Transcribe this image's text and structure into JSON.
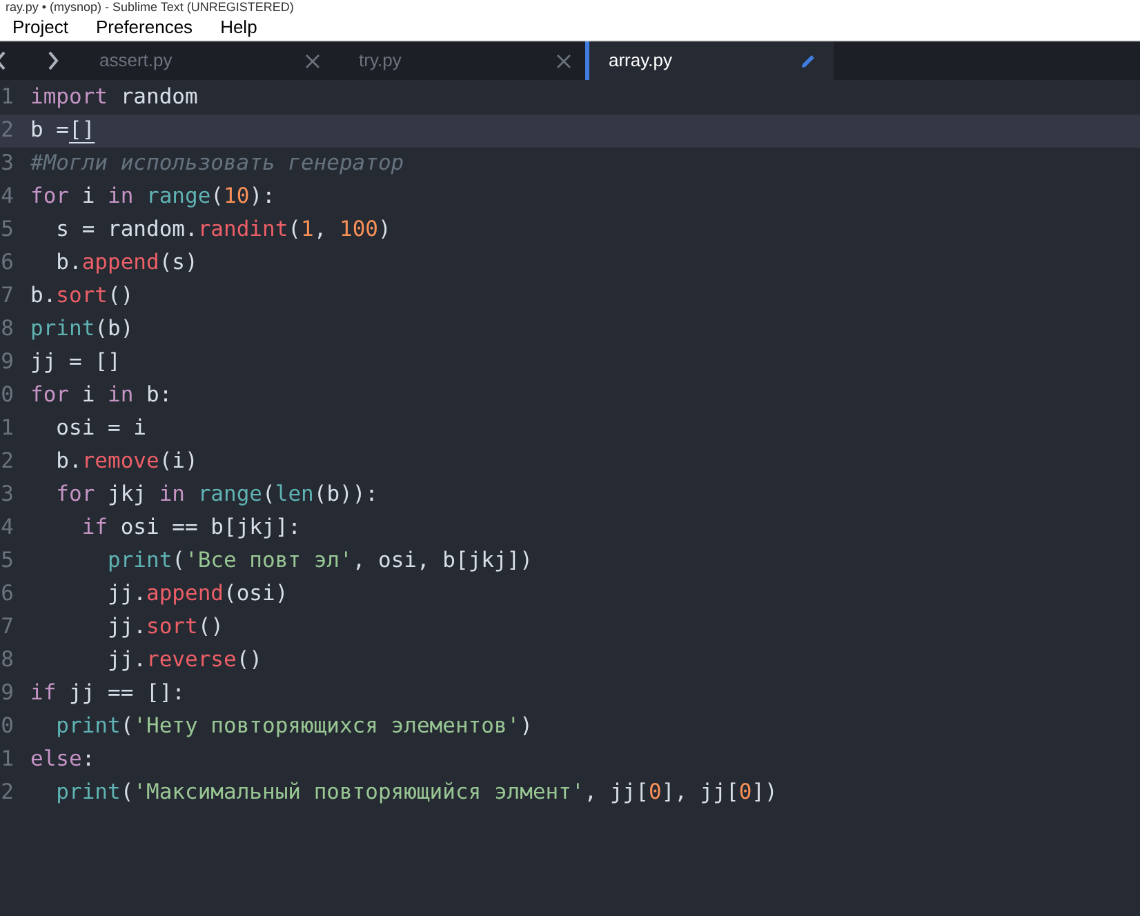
{
  "window": {
    "title": "ray.py • (mysnop) - Sublime Text (UNREGISTERED)"
  },
  "menu": [
    "Project",
    "Preferences",
    "Help"
  ],
  "tabs": [
    {
      "label": "assert.py",
      "selected": false,
      "modified": false
    },
    {
      "label": "try.py",
      "selected": false,
      "modified": false
    },
    {
      "label": "array.py",
      "selected": true,
      "modified": true
    }
  ],
  "lines": [
    {
      "number": "1",
      "current": false,
      "tokens": [
        {
          "kind": "kw",
          "text": "import"
        },
        {
          "kind": "tx",
          "text": " random"
        }
      ]
    },
    {
      "number": "2",
      "current": true,
      "tokens": [
        {
          "kind": "tx",
          "text": "b ="
        },
        {
          "kind": "match",
          "text": "[]"
        }
      ]
    },
    {
      "number": "3",
      "current": false,
      "tokens": [
        {
          "kind": "cm",
          "text": "#Могли использовать генератор"
        }
      ]
    },
    {
      "number": "4",
      "current": false,
      "tokens": [
        {
          "kind": "kw",
          "text": "for"
        },
        {
          "kind": "tx",
          "text": " i "
        },
        {
          "kind": "kw",
          "text": "in "
        },
        {
          "kind": "fn",
          "text": "range"
        },
        {
          "kind": "tx",
          "text": "("
        },
        {
          "kind": "num",
          "text": "10"
        },
        {
          "kind": "tx",
          "text": "):"
        }
      ]
    },
    {
      "number": "5",
      "current": false,
      "tokens": [
        {
          "kind": "tx",
          "text": "  s = random."
        },
        {
          "kind": "mt",
          "text": "randint"
        },
        {
          "kind": "tx",
          "text": "("
        },
        {
          "kind": "num",
          "text": "1"
        },
        {
          "kind": "tx",
          "text": ", "
        },
        {
          "kind": "num",
          "text": "100"
        },
        {
          "kind": "tx",
          "text": ")"
        }
      ]
    },
    {
      "number": "6",
      "current": false,
      "tokens": [
        {
          "kind": "tx",
          "text": "  b."
        },
        {
          "kind": "mt",
          "text": "append"
        },
        {
          "kind": "tx",
          "text": "(s)"
        }
      ]
    },
    {
      "number": "7",
      "current": false,
      "tokens": [
        {
          "kind": "tx",
          "text": "b."
        },
        {
          "kind": "mt",
          "text": "sort"
        },
        {
          "kind": "tx",
          "text": "()"
        }
      ]
    },
    {
      "number": "8",
      "current": false,
      "tokens": [
        {
          "kind": "fn",
          "text": "print"
        },
        {
          "kind": "tx",
          "text": "(b)"
        }
      ]
    },
    {
      "number": "9",
      "current": false,
      "tokens": [
        {
          "kind": "tx",
          "text": "jj = []"
        }
      ]
    },
    {
      "number": "0",
      "current": false,
      "tokens": [
        {
          "kind": "kw",
          "text": "for"
        },
        {
          "kind": "tx",
          "text": " i "
        },
        {
          "kind": "kw",
          "text": "in"
        },
        {
          "kind": "tx",
          "text": " b:"
        }
      ]
    },
    {
      "number": "1",
      "current": false,
      "tokens": [
        {
          "kind": "tx",
          "text": "  osi = i"
        }
      ]
    },
    {
      "number": "2",
      "current": false,
      "tokens": [
        {
          "kind": "tx",
          "text": "  b."
        },
        {
          "kind": "mt",
          "text": "remove"
        },
        {
          "kind": "tx",
          "text": "(i)"
        }
      ]
    },
    {
      "number": "3",
      "current": false,
      "tokens": [
        {
          "kind": "kw",
          "text": "  for"
        },
        {
          "kind": "tx",
          "text": " jkj "
        },
        {
          "kind": "kw",
          "text": "in "
        },
        {
          "kind": "fn",
          "text": "range"
        },
        {
          "kind": "tx",
          "text": "("
        },
        {
          "kind": "fn",
          "text": "len"
        },
        {
          "kind": "tx",
          "text": "(b)):"
        }
      ]
    },
    {
      "number": "4",
      "current": false,
      "tokens": [
        {
          "kind": "kw",
          "text": "    if"
        },
        {
          "kind": "tx",
          "text": " osi == b[jkj]:"
        }
      ]
    },
    {
      "number": "5",
      "current": false,
      "tokens": [
        {
          "kind": "fn",
          "text": "      print"
        },
        {
          "kind": "tx",
          "text": "("
        },
        {
          "kind": "st",
          "text": "'Все повт эл'"
        },
        {
          "kind": "tx",
          "text": ", osi, b[jkj])"
        }
      ]
    },
    {
      "number": "6",
      "current": false,
      "tokens": [
        {
          "kind": "tx",
          "text": "      jj."
        },
        {
          "kind": "mt",
          "text": "append"
        },
        {
          "kind": "tx",
          "text": "(osi)"
        }
      ]
    },
    {
      "number": "7",
      "current": false,
      "tokens": [
        {
          "kind": "tx",
          "text": "      jj."
        },
        {
          "kind": "mt",
          "text": "sort"
        },
        {
          "kind": "tx",
          "text": "()"
        }
      ]
    },
    {
      "number": "8",
      "current": false,
      "tokens": [
        {
          "kind": "tx",
          "text": "      jj."
        },
        {
          "kind": "mt",
          "text": "reverse"
        },
        {
          "kind": "tx",
          "text": "()"
        }
      ]
    },
    {
      "number": "9",
      "current": false,
      "tokens": [
        {
          "kind": "kw",
          "text": "if"
        },
        {
          "kind": "tx",
          "text": " jj == []:"
        }
      ]
    },
    {
      "number": "0",
      "current": false,
      "tokens": [
        {
          "kind": "fn",
          "text": "  print"
        },
        {
          "kind": "tx",
          "text": "("
        },
        {
          "kind": "st",
          "text": "'Нету повторяющихся элементов'"
        },
        {
          "kind": "tx",
          "text": ")"
        }
      ]
    },
    {
      "number": "1",
      "current": false,
      "tokens": [
        {
          "kind": "kw",
          "text": "else"
        },
        {
          "kind": "tx",
          "text": ":"
        }
      ]
    },
    {
      "number": "2",
      "current": false,
      "tokens": [
        {
          "kind": "fn",
          "text": "  print"
        },
        {
          "kind": "tx",
          "text": "("
        },
        {
          "kind": "st",
          "text": "'Максимальный повторяющийся элмент'"
        },
        {
          "kind": "tx",
          "text": ", jj["
        },
        {
          "kind": "num",
          "text": "0"
        },
        {
          "kind": "tx",
          "text": "], jj["
        },
        {
          "kind": "num",
          "text": "0"
        },
        {
          "kind": "tx",
          "text": "])"
        }
      ]
    }
  ]
}
